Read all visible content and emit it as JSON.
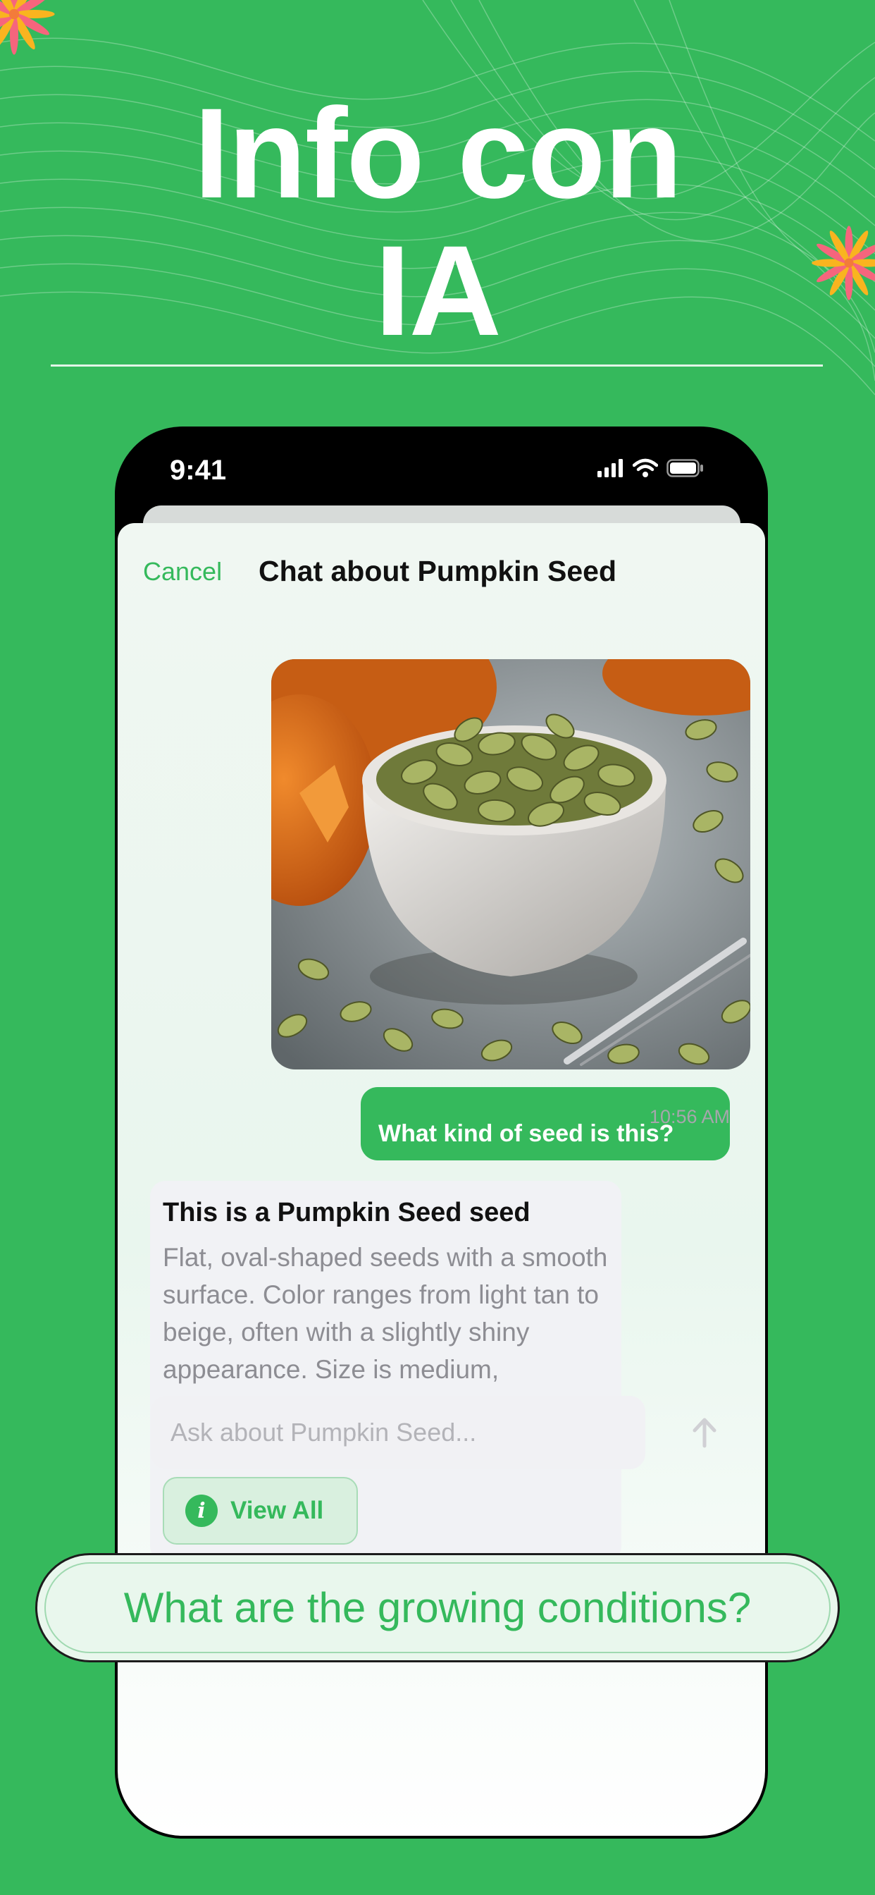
{
  "hero": {
    "title_line1": "Info con",
    "title_line2": "IA"
  },
  "status_bar": {
    "time": "9:41"
  },
  "chat": {
    "cancel_label": "Cancel",
    "title": "Chat about Pumpkin Seed",
    "user_message": "What kind of seed is this?",
    "timestamp": "10:56 AM",
    "ai_heading": "This is a Pumpkin Seed seed",
    "ai_body": "Flat, oval-shaped seeds with a smooth surface. Color ranges from light tan to beige, often with a slightly shiny appearance. Size is medium, approximately 1-2 cm in length.",
    "view_all_label": "View All",
    "input_placeholder": "Ask about Pumpkin Seed..."
  },
  "suggestion": {
    "text": "What are the growing conditions?"
  },
  "icons": {
    "signal": "cellular-signal-icon",
    "wifi": "wifi-icon",
    "battery": "battery-icon",
    "info": "info-icon",
    "send": "arrow-up-icon"
  },
  "colors": {
    "brand_green": "#35b95c",
    "background": "#35b95c",
    "card": "#f1f2f5"
  }
}
